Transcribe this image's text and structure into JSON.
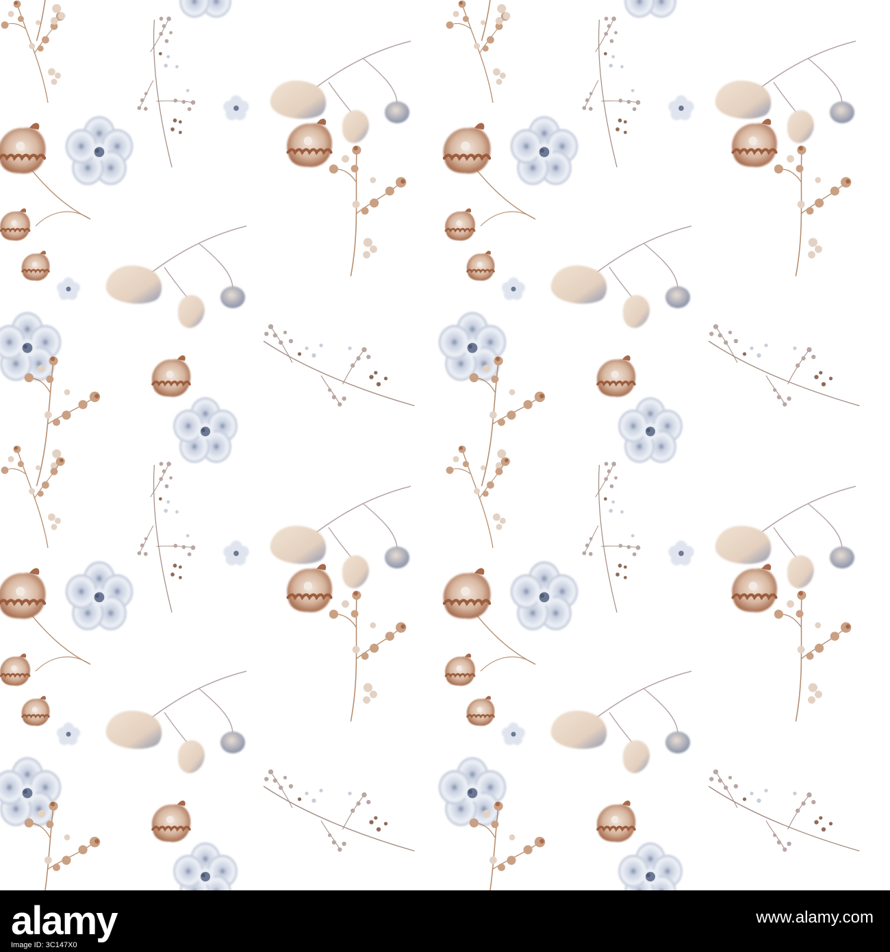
{
  "illustration": {
    "subject": "seamless watercolor floral pattern",
    "palette": {
      "background": "#ffffff",
      "dusty_blue": "#9aa6bf",
      "pale_blue": "#e3e8f1",
      "blue_center": "#6c7893",
      "rust": "#a86a4a",
      "tan": "#c9a083",
      "peach": "#ead7c6",
      "stem": "#b48a6a"
    },
    "motif_icons": [
      "blue-flower-icon",
      "rust-carnation-icon",
      "leaf-sprig-icon",
      "berry-branch-icon",
      "seed-spray-icon",
      "small-blossom-icon"
    ]
  },
  "footer": {
    "logo_text_bold": "alamy",
    "image_id_text": "Image ID: 3C147X0",
    "url_text": "www.alamy.com",
    "bar_color": "#000000",
    "text_color": "#ffffff"
  }
}
